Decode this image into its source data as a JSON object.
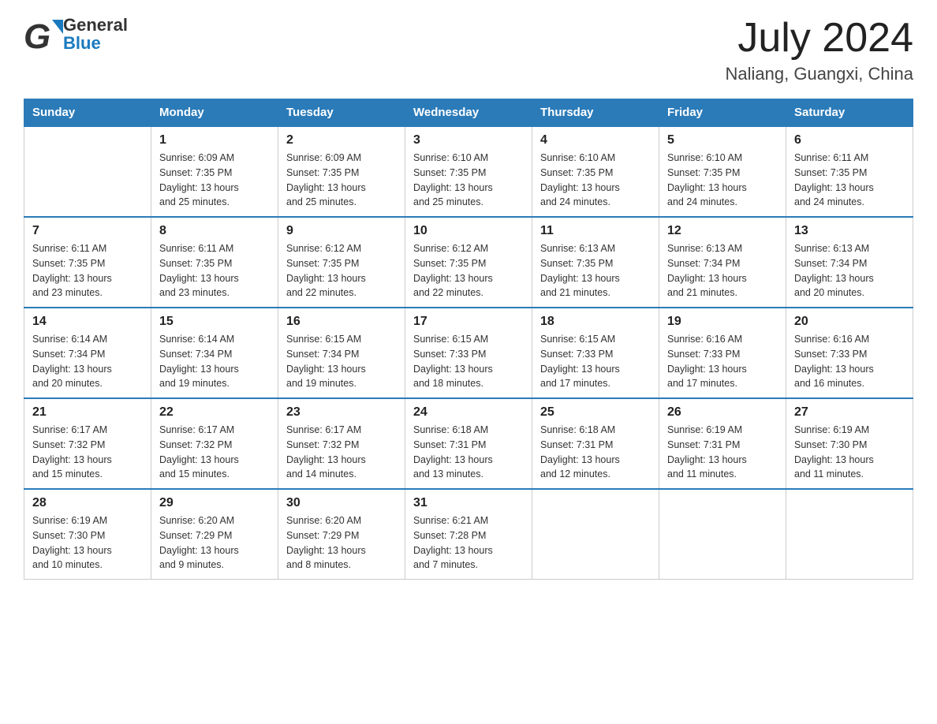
{
  "header": {
    "title": "July 2024",
    "subtitle": "Naliang, Guangxi, China",
    "logo_general": "General",
    "logo_blue": "Blue"
  },
  "calendar": {
    "days_of_week": [
      "Sunday",
      "Monday",
      "Tuesday",
      "Wednesday",
      "Thursday",
      "Friday",
      "Saturday"
    ],
    "weeks": [
      [
        {
          "day": "",
          "info": ""
        },
        {
          "day": "1",
          "info": "Sunrise: 6:09 AM\nSunset: 7:35 PM\nDaylight: 13 hours\nand 25 minutes."
        },
        {
          "day": "2",
          "info": "Sunrise: 6:09 AM\nSunset: 7:35 PM\nDaylight: 13 hours\nand 25 minutes."
        },
        {
          "day": "3",
          "info": "Sunrise: 6:10 AM\nSunset: 7:35 PM\nDaylight: 13 hours\nand 25 minutes."
        },
        {
          "day": "4",
          "info": "Sunrise: 6:10 AM\nSunset: 7:35 PM\nDaylight: 13 hours\nand 24 minutes."
        },
        {
          "day": "5",
          "info": "Sunrise: 6:10 AM\nSunset: 7:35 PM\nDaylight: 13 hours\nand 24 minutes."
        },
        {
          "day": "6",
          "info": "Sunrise: 6:11 AM\nSunset: 7:35 PM\nDaylight: 13 hours\nand 24 minutes."
        }
      ],
      [
        {
          "day": "7",
          "info": "Sunrise: 6:11 AM\nSunset: 7:35 PM\nDaylight: 13 hours\nand 23 minutes."
        },
        {
          "day": "8",
          "info": "Sunrise: 6:11 AM\nSunset: 7:35 PM\nDaylight: 13 hours\nand 23 minutes."
        },
        {
          "day": "9",
          "info": "Sunrise: 6:12 AM\nSunset: 7:35 PM\nDaylight: 13 hours\nand 22 minutes."
        },
        {
          "day": "10",
          "info": "Sunrise: 6:12 AM\nSunset: 7:35 PM\nDaylight: 13 hours\nand 22 minutes."
        },
        {
          "day": "11",
          "info": "Sunrise: 6:13 AM\nSunset: 7:35 PM\nDaylight: 13 hours\nand 21 minutes."
        },
        {
          "day": "12",
          "info": "Sunrise: 6:13 AM\nSunset: 7:34 PM\nDaylight: 13 hours\nand 21 minutes."
        },
        {
          "day": "13",
          "info": "Sunrise: 6:13 AM\nSunset: 7:34 PM\nDaylight: 13 hours\nand 20 minutes."
        }
      ],
      [
        {
          "day": "14",
          "info": "Sunrise: 6:14 AM\nSunset: 7:34 PM\nDaylight: 13 hours\nand 20 minutes."
        },
        {
          "day": "15",
          "info": "Sunrise: 6:14 AM\nSunset: 7:34 PM\nDaylight: 13 hours\nand 19 minutes."
        },
        {
          "day": "16",
          "info": "Sunrise: 6:15 AM\nSunset: 7:34 PM\nDaylight: 13 hours\nand 19 minutes."
        },
        {
          "day": "17",
          "info": "Sunrise: 6:15 AM\nSunset: 7:33 PM\nDaylight: 13 hours\nand 18 minutes."
        },
        {
          "day": "18",
          "info": "Sunrise: 6:15 AM\nSunset: 7:33 PM\nDaylight: 13 hours\nand 17 minutes."
        },
        {
          "day": "19",
          "info": "Sunrise: 6:16 AM\nSunset: 7:33 PM\nDaylight: 13 hours\nand 17 minutes."
        },
        {
          "day": "20",
          "info": "Sunrise: 6:16 AM\nSunset: 7:33 PM\nDaylight: 13 hours\nand 16 minutes."
        }
      ],
      [
        {
          "day": "21",
          "info": "Sunrise: 6:17 AM\nSunset: 7:32 PM\nDaylight: 13 hours\nand 15 minutes."
        },
        {
          "day": "22",
          "info": "Sunrise: 6:17 AM\nSunset: 7:32 PM\nDaylight: 13 hours\nand 15 minutes."
        },
        {
          "day": "23",
          "info": "Sunrise: 6:17 AM\nSunset: 7:32 PM\nDaylight: 13 hours\nand 14 minutes."
        },
        {
          "day": "24",
          "info": "Sunrise: 6:18 AM\nSunset: 7:31 PM\nDaylight: 13 hours\nand 13 minutes."
        },
        {
          "day": "25",
          "info": "Sunrise: 6:18 AM\nSunset: 7:31 PM\nDaylight: 13 hours\nand 12 minutes."
        },
        {
          "day": "26",
          "info": "Sunrise: 6:19 AM\nSunset: 7:31 PM\nDaylight: 13 hours\nand 11 minutes."
        },
        {
          "day": "27",
          "info": "Sunrise: 6:19 AM\nSunset: 7:30 PM\nDaylight: 13 hours\nand 11 minutes."
        }
      ],
      [
        {
          "day": "28",
          "info": "Sunrise: 6:19 AM\nSunset: 7:30 PM\nDaylight: 13 hours\nand 10 minutes."
        },
        {
          "day": "29",
          "info": "Sunrise: 6:20 AM\nSunset: 7:29 PM\nDaylight: 13 hours\nand 9 minutes."
        },
        {
          "day": "30",
          "info": "Sunrise: 6:20 AM\nSunset: 7:29 PM\nDaylight: 13 hours\nand 8 minutes."
        },
        {
          "day": "31",
          "info": "Sunrise: 6:21 AM\nSunset: 7:28 PM\nDaylight: 13 hours\nand 7 minutes."
        },
        {
          "day": "",
          "info": ""
        },
        {
          "day": "",
          "info": ""
        },
        {
          "day": "",
          "info": ""
        }
      ]
    ]
  }
}
